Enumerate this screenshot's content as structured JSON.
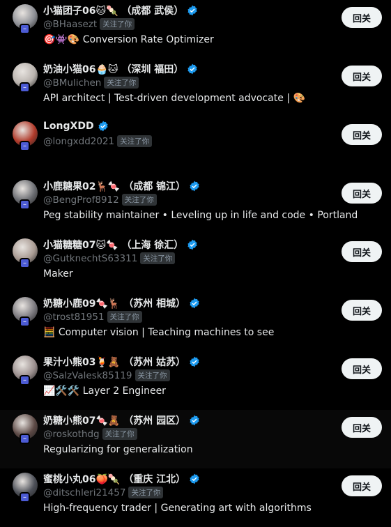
{
  "colors": {
    "background": "#000000",
    "verified": "#1d9bf0",
    "button_bg": "#eff3f4"
  },
  "users": [
    {
      "name": "小猫团子06🐱🍡 （成都 武侯）",
      "handle": "@BHaasezt",
      "follows_you": "关注了你",
      "bio": "🎯👾🎨 Conversion Rate Optimizer",
      "button": "回关",
      "avatar_color": "#8d8f95"
    },
    {
      "name": "奶油小猫06🧁🐱 （深圳 福田）",
      "handle": "@BMulichen",
      "follows_you": "关注了你",
      "bio": "API architect | Test-driven development advocate | 🎨",
      "button": "回关",
      "avatar_color": "#b9b3ae"
    },
    {
      "name": "LongXDD",
      "handle": "@longxdd2021",
      "follows_you": "关注了你",
      "bio": "",
      "button": "回关",
      "avatar_color": "#b03a2a"
    },
    {
      "name": "小鹿糖果02🦌🍬 （成都 锦江）",
      "handle": "@BengProf8912",
      "follows_you": "关注了你",
      "bio": "Peg stability maintainer • Leveling up in life and code • Portland",
      "button": "回关",
      "avatar_color": "#6b6d72"
    },
    {
      "name": "小猫糖糖07🐱🍬 （上海 徐汇）",
      "handle": "@GutknechtS63311",
      "follows_you": "关注了你",
      "bio": "Maker",
      "button": "回关",
      "avatar_color": "#a89a92"
    },
    {
      "name": "奶糖小鹿09🍬🦌 （苏州 相城）",
      "handle": "@trost81951",
      "follows_you": "关注了你",
      "bio": "🧮 Computer vision | Teaching machines to see",
      "button": "回关",
      "avatar_color": "#7c7a7f"
    },
    {
      "name": "果汁小熊03🍹🧸 （苏州 姑苏）",
      "handle": "@SalzValesk85119",
      "follows_you": "关注了你",
      "bio": "📈🛠️🛠️ Layer 2 Engineer",
      "button": "回关",
      "avatar_color": "#9b8f8e"
    },
    {
      "name": "奶糖小熊07🍬🧸 （苏州 园区）",
      "handle": "@roskothdg",
      "follows_you": "关注了你",
      "bio": "Regularizing for generalization",
      "button": "回关",
      "avatar_color": "#5d4a46"
    },
    {
      "name": "蜜桃小丸06🍑🍡 （重庆 江北）",
      "handle": "@ditschleri21457",
      "follows_you": "关注了你",
      "bio": "High-frequency trader | Generating art with algorithms",
      "button": "回关",
      "avatar_color": "#4d5058"
    }
  ]
}
